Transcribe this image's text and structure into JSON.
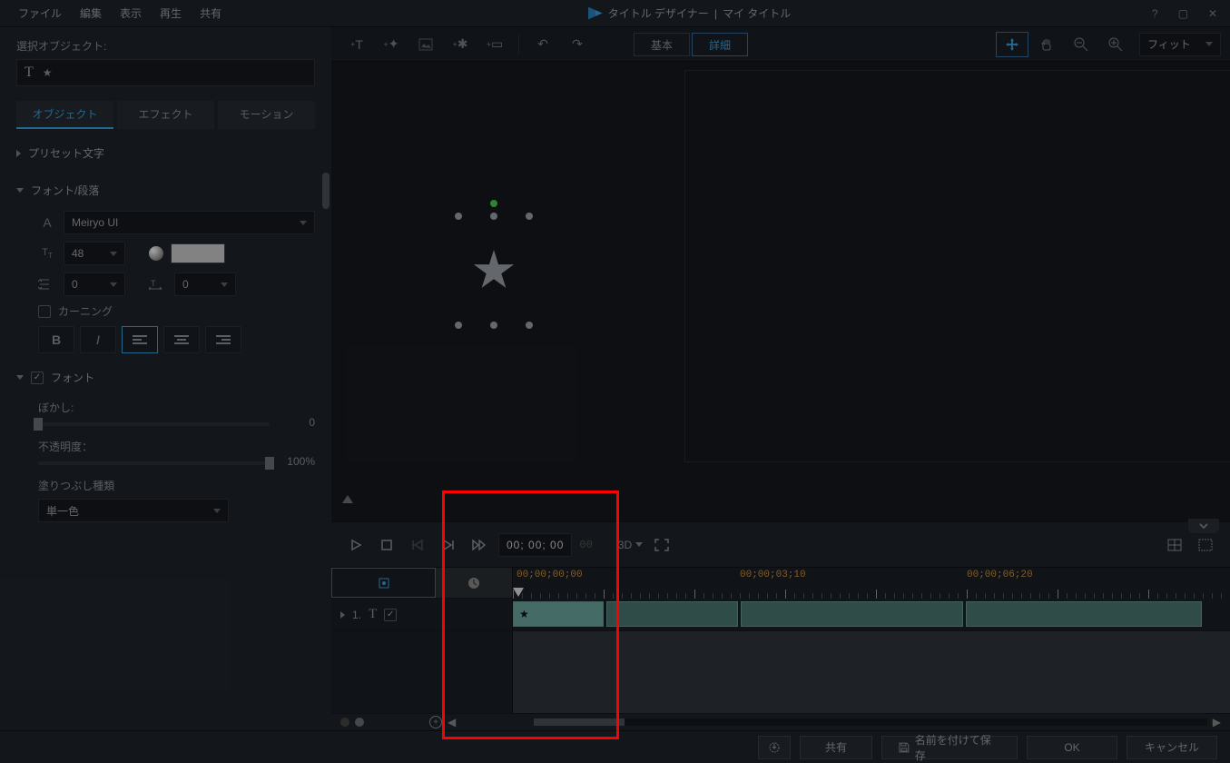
{
  "window": {
    "title": "タイトル デザイナー",
    "subtitle": "マイ タイトル",
    "separator": "|"
  },
  "menubar": {
    "file": "ファイル",
    "edit": "編集",
    "view": "表示",
    "play": "再生",
    "share": "共有"
  },
  "sidebar": {
    "selectedObjectsLabel": "選択オブジェクト:",
    "selectedObjectText": "★",
    "tabs": {
      "object": "オブジェクト",
      "effect": "エフェクト",
      "motion": "モーション"
    },
    "presetText": "プリセット文字",
    "fontParagraph": "フォント/段落",
    "font": {
      "family": "Meiryo UI",
      "size": "48",
      "lineSpacing": "0",
      "charSpacing": "0",
      "kerning": "カーニング"
    },
    "fontSection": "フォント",
    "blur": {
      "label": "ぼかし:",
      "value": "0"
    },
    "opacity": {
      "label": "不透明度：",
      "value": "100%"
    },
    "fillType": {
      "label": "塗りつぶし種類",
      "value": "単一色"
    }
  },
  "toolbar": {
    "basic": "基本",
    "advanced": "詳細",
    "fit": "フィット"
  },
  "playback": {
    "timecode": "00; 00; 00",
    "timecodeSuffix": "00",
    "threeD": "3D"
  },
  "timeline": {
    "rulerStart": "00;00;00;00",
    "rulerMid": "00;00;03;10",
    "rulerEnd": "00;00;06;20",
    "track1Num": "1.",
    "clip1Label": "★"
  },
  "footer": {
    "share": "共有",
    "saveAs": "名前を付けて保存",
    "ok": "OK",
    "cancel": "キャンセル"
  }
}
